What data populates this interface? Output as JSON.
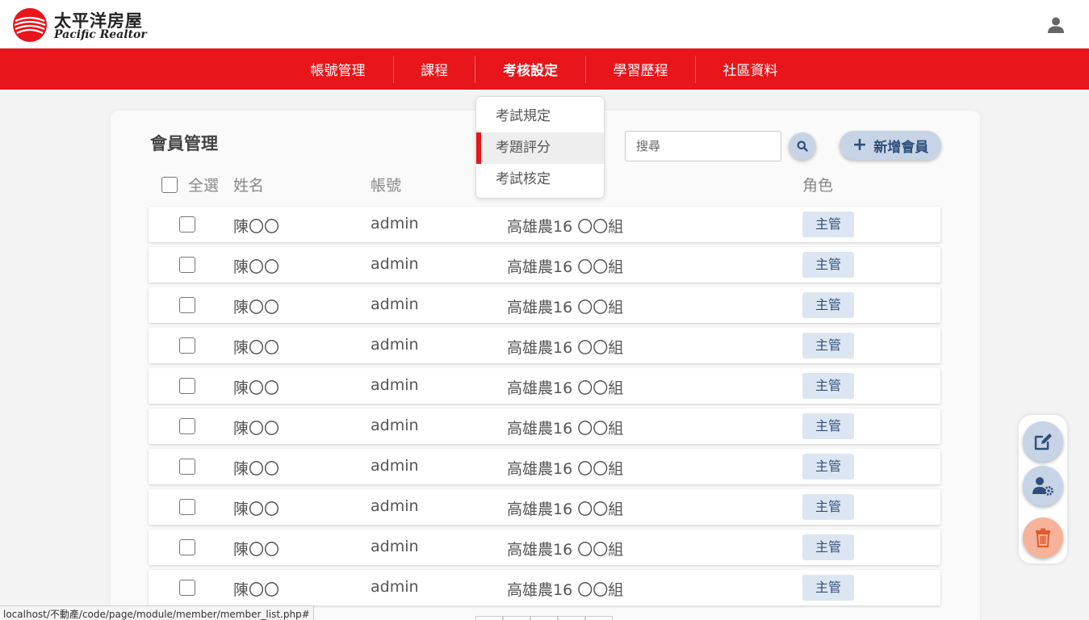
{
  "header": {
    "logo_cn": "太平洋房屋",
    "logo_en": "Pacific Realtor"
  },
  "nav": {
    "items": [
      {
        "label": "帳號管理"
      },
      {
        "label": "課程"
      },
      {
        "label": "考核設定"
      },
      {
        "label": "學習歷程"
      },
      {
        "label": "社區資料"
      }
    ],
    "active_index": 2
  },
  "dropdown": {
    "items": [
      {
        "label": "考試規定"
      },
      {
        "label": "考題評分"
      },
      {
        "label": "考試核定"
      }
    ],
    "active_index": 1
  },
  "page": {
    "title": "會員管理",
    "search_placeholder": "搜尋",
    "add_button_label": "新增會員"
  },
  "table": {
    "select_all_label": "全選",
    "columns": {
      "name": "姓名",
      "account": "帳號",
      "role": "角色"
    },
    "rows": [
      {
        "name": "陳〇〇",
        "account": "admin",
        "group": "高雄農16 〇〇組",
        "role": "主管"
      },
      {
        "name": "陳〇〇",
        "account": "admin",
        "group": "高雄農16 〇〇組",
        "role": "主管"
      },
      {
        "name": "陳〇〇",
        "account": "admin",
        "group": "高雄農16 〇〇組",
        "role": "主管"
      },
      {
        "name": "陳〇〇",
        "account": "admin",
        "group": "高雄農16 〇〇組",
        "role": "主管"
      },
      {
        "name": "陳〇〇",
        "account": "admin",
        "group": "高雄農16 〇〇組",
        "role": "主管"
      },
      {
        "name": "陳〇〇",
        "account": "admin",
        "group": "高雄農16 〇〇組",
        "role": "主管"
      },
      {
        "name": "陳〇〇",
        "account": "admin",
        "group": "高雄農16 〇〇組",
        "role": "主管"
      },
      {
        "name": "陳〇〇",
        "account": "admin",
        "group": "高雄農16 〇〇組",
        "role": "主管"
      },
      {
        "name": "陳〇〇",
        "account": "admin",
        "group": "高雄農16 〇〇組",
        "role": "主管"
      },
      {
        "name": "陳〇〇",
        "account": "admin",
        "group": "高雄農16 〇〇組",
        "role": "主管"
      }
    ]
  },
  "fab": {
    "icons": [
      "edit-icon",
      "user-settings-icon",
      "trash-icon"
    ]
  },
  "statusbar": {
    "url": "localhost/不動產/code/page/module/member/member_list.php#"
  },
  "colors": {
    "brand_red": "#e8151b",
    "button_blue": "#c7d4e6",
    "badge_blue": "#dce6f2",
    "delete_orange": "#f6b39a"
  }
}
